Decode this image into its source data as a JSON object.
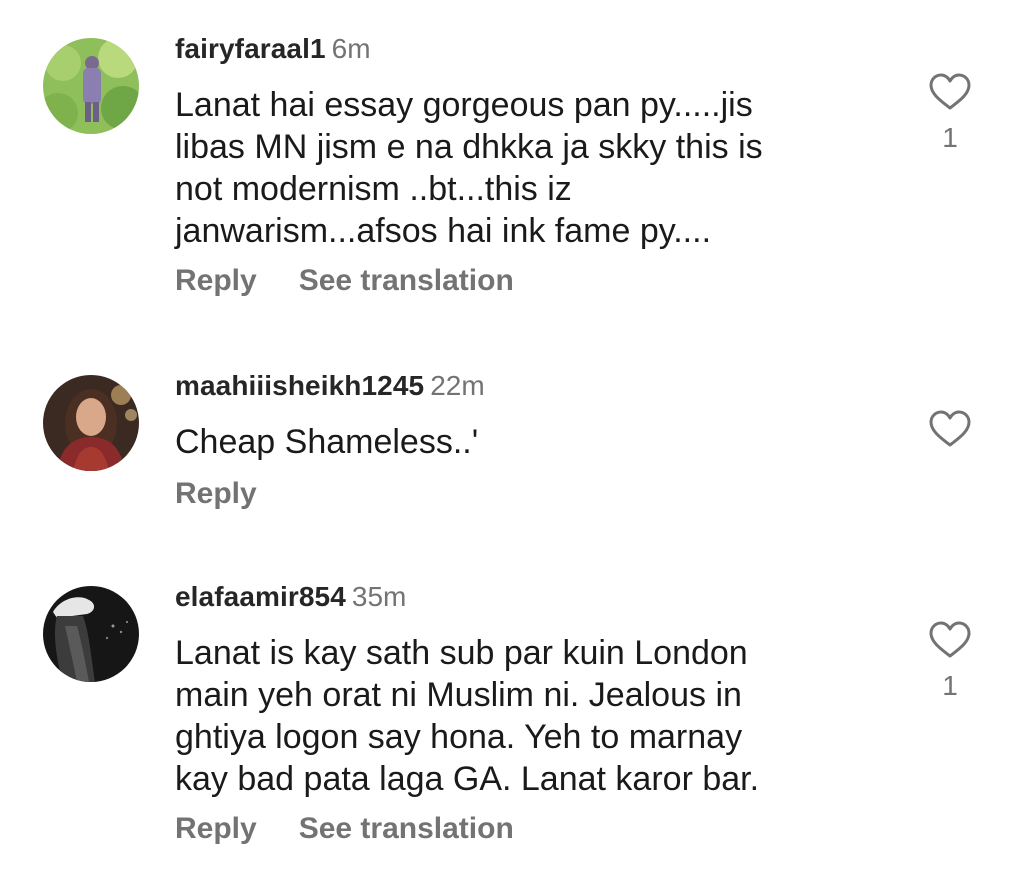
{
  "comments": [
    {
      "username": "fairyfaraal1",
      "time": "6m",
      "text": "Lanat hai essay gorgeous pan py.....jis\nlibas MN jism e na dhkka ja skky this is\nnot modernism ..bt...this iz\njanwarism...afsos hai ink fame py....",
      "reply_label": "Reply",
      "translate_label": "See translation",
      "like_count": "1"
    },
    {
      "username": "maahiiisheikh1245",
      "time": "22m",
      "text": "Cheap Shameless..'",
      "reply_label": "Reply",
      "like_count": ""
    },
    {
      "username": "elafaamir854",
      "time": "35m",
      "text": "Lanat is kay sath sub par kuin London\nmain yeh orat ni Muslim ni. Jealous in\nghtiya logon say hona. Yeh to marnay\nkay bad pata laga GA. Lanat karor bar.",
      "reply_label": "Reply",
      "translate_label": "See translation",
      "like_count": "1"
    }
  ],
  "icons": {
    "like": "heart-outline-icon"
  },
  "colors": {
    "text_primary": "#1a1a1a",
    "text_secondary": "#737373",
    "background": "#ffffff"
  }
}
